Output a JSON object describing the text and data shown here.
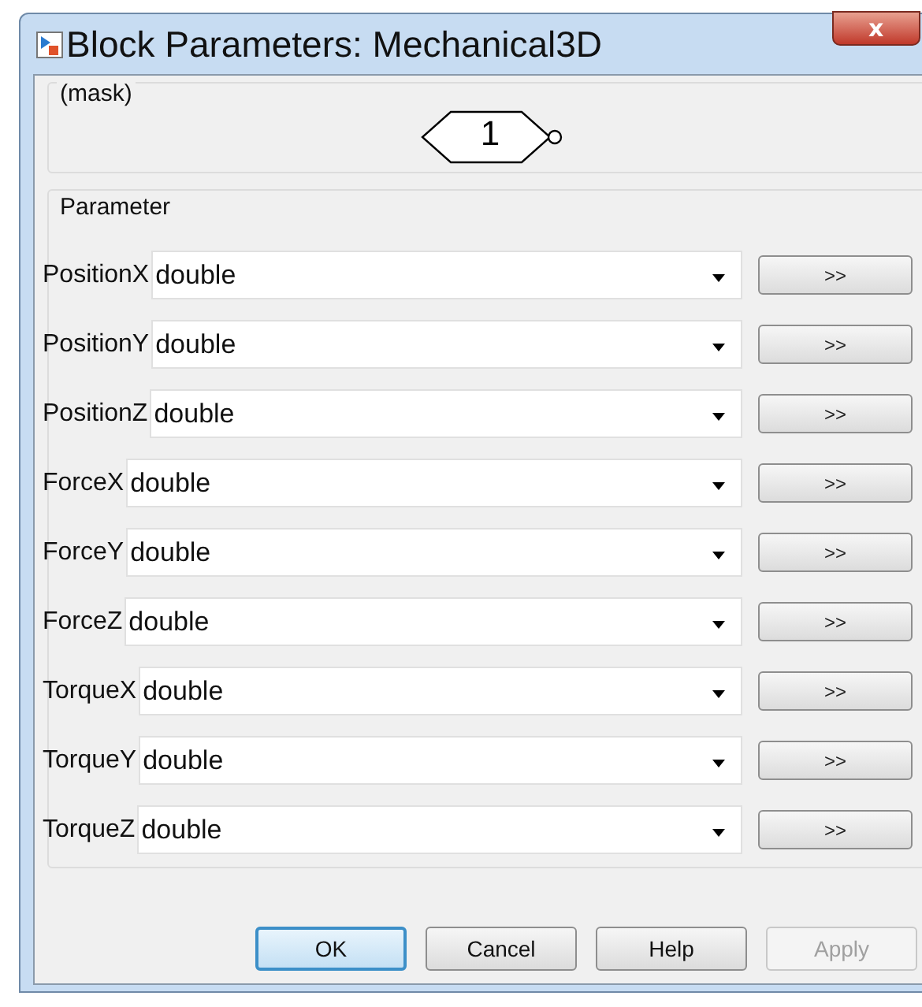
{
  "window": {
    "title": "Block Parameters: Mechanical3D",
    "close": "x"
  },
  "mask": {
    "label": "(mask)",
    "block_value": "1"
  },
  "parameters": {
    "label": "Parameter",
    "rows": [
      {
        "name": "PositionX",
        "value": "double",
        "button": ">>"
      },
      {
        "name": "PositionY",
        "value": "double",
        "button": ">>"
      },
      {
        "name": "PositionZ",
        "value": "double",
        "button": ">>"
      },
      {
        "name": "ForceX",
        "value": "double",
        "button": ">>"
      },
      {
        "name": "ForceY",
        "value": "double",
        "button": ">>"
      },
      {
        "name": "ForceZ",
        "value": "double",
        "button": ">>"
      },
      {
        "name": "TorqueX",
        "value": "double",
        "button": ">>"
      },
      {
        "name": "TorqueY",
        "value": "double",
        "button": ">>"
      },
      {
        "name": "TorqueZ",
        "value": "double",
        "button": ">>"
      }
    ]
  },
  "buttons": [
    {
      "label": "OK",
      "default": true,
      "disabled": false
    },
    {
      "label": "Cancel",
      "default": false,
      "disabled": false
    },
    {
      "label": "Help",
      "default": false,
      "disabled": false
    },
    {
      "label": "Apply",
      "default": false,
      "disabled": true
    }
  ]
}
